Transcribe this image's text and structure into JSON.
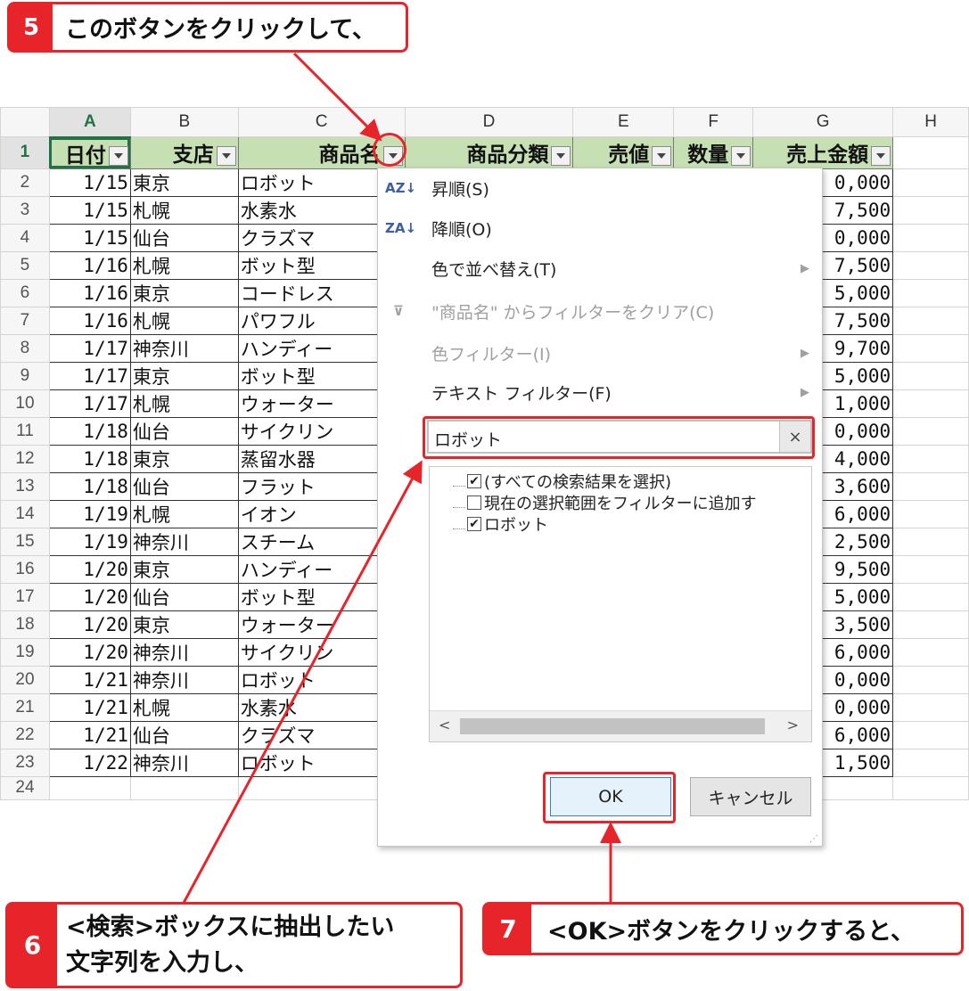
{
  "callouts": [
    {
      "num": "5",
      "text": "このボタンをクリックして、"
    },
    {
      "num": "6",
      "line1": "<検索>ボックスに抽出したい",
      "line2": "文字列を入力し、"
    },
    {
      "num": "7",
      "text": "<OK>ボタンをクリックすると、"
    }
  ],
  "columns": [
    "A",
    "B",
    "C",
    "D",
    "E",
    "F",
    "G",
    "H"
  ],
  "filter_headers": [
    "日付",
    "支店",
    "商品名",
    "商品分類",
    "売値",
    "数量",
    "売上金額"
  ],
  "rows": [
    {
      "n": "1"
    },
    {
      "n": "2",
      "date": "1/15",
      "branch": "東京",
      "product": "ロボット",
      "amount": "0,000"
    },
    {
      "n": "3",
      "date": "1/15",
      "branch": "札幌",
      "product": "水素水",
      "amount": "7,500"
    },
    {
      "n": "4",
      "date": "1/15",
      "branch": "仙台",
      "product": "クラズマ",
      "amount": "0,000"
    },
    {
      "n": "5",
      "date": "1/16",
      "branch": "札幌",
      "product": "ボット型",
      "amount": "7,500"
    },
    {
      "n": "6",
      "date": "1/16",
      "branch": "東京",
      "product": "コードレス",
      "amount": "5,000"
    },
    {
      "n": "7",
      "date": "1/16",
      "branch": "札幌",
      "product": "パワフル",
      "amount": "7,500"
    },
    {
      "n": "8",
      "date": "1/17",
      "branch": "神奈川",
      "product": "ハンディー",
      "amount": "9,700"
    },
    {
      "n": "9",
      "date": "1/17",
      "branch": "東京",
      "product": "ボット型",
      "amount": "5,000"
    },
    {
      "n": "10",
      "date": "1/17",
      "branch": "札幌",
      "product": "ウォーター",
      "amount": "1,000"
    },
    {
      "n": "11",
      "date": "1/18",
      "branch": "仙台",
      "product": "サイクリン",
      "amount": "0,000"
    },
    {
      "n": "12",
      "date": "1/18",
      "branch": "東京",
      "product": "蒸留水器",
      "amount": "4,000"
    },
    {
      "n": "13",
      "date": "1/18",
      "branch": "仙台",
      "product": "フラット",
      "amount": "3,600"
    },
    {
      "n": "14",
      "date": "1/19",
      "branch": "札幌",
      "product": "イオン",
      "amount": "6,000"
    },
    {
      "n": "15",
      "date": "1/19",
      "branch": "神奈川",
      "product": "スチーム",
      "amount": "2,500"
    },
    {
      "n": "16",
      "date": "1/20",
      "branch": "東京",
      "product": "ハンディー",
      "amount": "9,500"
    },
    {
      "n": "17",
      "date": "1/20",
      "branch": "仙台",
      "product": "ボット型",
      "amount": "5,000"
    },
    {
      "n": "18",
      "date": "1/20",
      "branch": "東京",
      "product": "ウォーター",
      "amount": "3,500"
    },
    {
      "n": "19",
      "date": "1/20",
      "branch": "神奈川",
      "product": "サイクリン",
      "amount": "6,000"
    },
    {
      "n": "20",
      "date": "1/21",
      "branch": "神奈川",
      "product": "ロボット",
      "amount": "0,000"
    },
    {
      "n": "21",
      "date": "1/21",
      "branch": "札幌",
      "product": "水素水",
      "amount": "0,000"
    },
    {
      "n": "22",
      "date": "1/21",
      "branch": "仙台",
      "product": "クラズマ",
      "amount": "6,000"
    },
    {
      "n": "23",
      "date": "1/22",
      "branch": "神奈川",
      "product": "ロボット",
      "amount": "1,500"
    },
    {
      "n": "24"
    }
  ],
  "menu": {
    "sort_asc": "昇順(S)",
    "sort_asc_icon": "AZ↓",
    "sort_desc": "降順(O)",
    "sort_desc_icon": "ZA↓",
    "sort_color": "色で並べ替え(T)",
    "clear_filter": "\"商品名\" からフィルターをクリア(C)",
    "color_filter": "色フィルター(I)",
    "text_filter": "テキスト フィルター(F)",
    "search_value": "ロボット",
    "search_clear": "×",
    "list_items": [
      "(すべての検索結果を選択)",
      "現在の選択範囲をフィルターに追加す",
      "ロボット"
    ],
    "ok_label": "OK",
    "cancel_label": "キャンセル"
  }
}
